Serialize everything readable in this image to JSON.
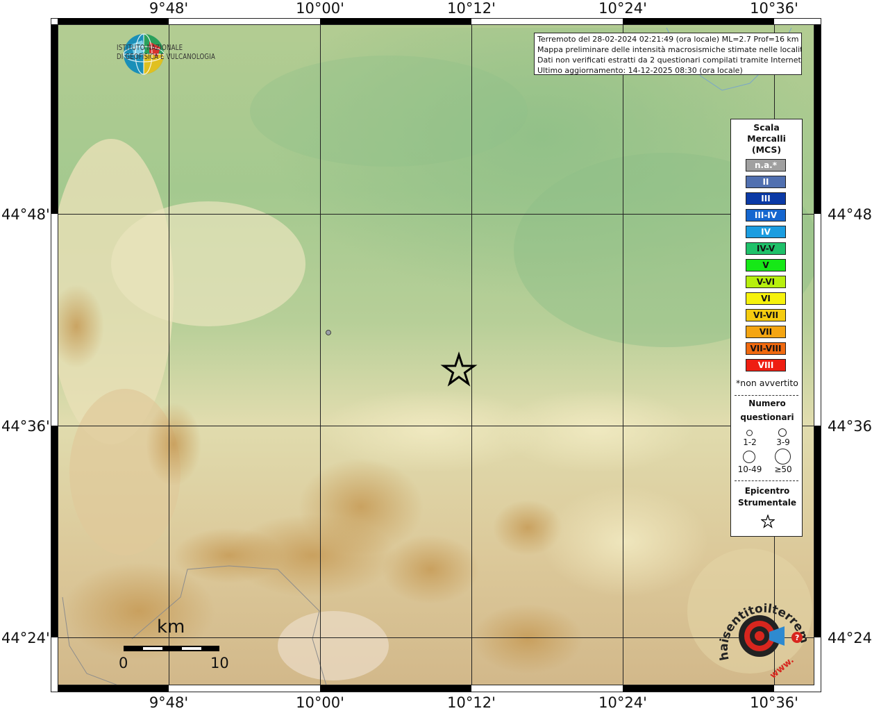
{
  "map": {
    "frame_labels": {
      "longitudes": [
        "9°48'",
        "10°00'",
        "10°12'",
        "10°24'",
        "10°36'"
      ],
      "latitudes": [
        "44°48'",
        "44°36'",
        "44°24'"
      ]
    },
    "info": {
      "line1": "Terremoto del 28-02-2024 02:21:49 (ora locale) ML=2.7 Prof=16 km",
      "line2": "Mappa preliminare delle intensità macrosismiche stimate nelle località",
      "line3": "Dati non verificati estratti da 2 questionari compilati tramite Internet.",
      "line4": "Ultimo aggiornamento: 14-12-2025 08:30 (ora locale)"
    },
    "ingv_logo": {
      "line1": "ISTITUTO NAZIONALE",
      "line2": "DI GEOFISICA E VULCANOLOGIA"
    },
    "legend": {
      "title1": "Scala",
      "title2": "Mercalli",
      "title3": "(MCS)",
      "intensities": [
        {
          "label": "n.a.*",
          "color": "#a0a0a0",
          "text_color": "#ffffff"
        },
        {
          "label": "II",
          "color": "#5170b0",
          "text_color": "#ffffff"
        },
        {
          "label": "III",
          "color": "#0b3aa6",
          "text_color": "#ffffff"
        },
        {
          "label": "III-IV",
          "color": "#1566cf",
          "text_color": "#ffffff"
        },
        {
          "label": "IV",
          "color": "#1b9de0",
          "text_color": "#ffffff"
        },
        {
          "label": "IV-V",
          "color": "#1fc16a",
          "text_color": "#111111"
        },
        {
          "label": "V",
          "color": "#16e817",
          "text_color": "#111111"
        },
        {
          "label": "V-VI",
          "color": "#b7ef0e",
          "text_color": "#111111"
        },
        {
          "label": "VI",
          "color": "#f6f20c",
          "text_color": "#111111"
        },
        {
          "label": "VI-VII",
          "color": "#f5cc10",
          "text_color": "#111111"
        },
        {
          "label": "VII",
          "color": "#f4a512",
          "text_color": "#111111"
        },
        {
          "label": "VII-VIII",
          "color": "#f06a10",
          "text_color": "#111111"
        },
        {
          "label": "VIII",
          "color": "#ee1e12",
          "text_color": "#ffffff"
        }
      ],
      "not_felt_note": "*non avvertito",
      "count_title1": "Numero",
      "count_title2": "questionari",
      "count_classes": [
        "1-2",
        "3-9",
        "10-49",
        "≥50"
      ],
      "epicenter_title1": "Epicentro",
      "epicenter_title2": "Strumentale"
    },
    "scalebar": {
      "unit": "km",
      "start": "0",
      "end": "10"
    },
    "hst_logo": {
      "text": "haisentitoilterremoto.it",
      "url_text": "www."
    },
    "epicenter_icon": "star-icon",
    "questionnaire_marker_class": "1-2"
  }
}
